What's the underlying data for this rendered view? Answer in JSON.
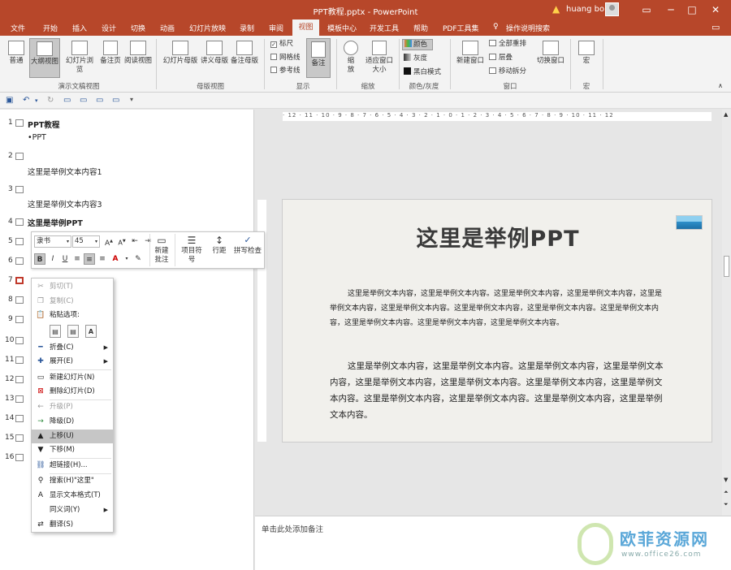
{
  "titlebar": {
    "title": "PPT教程.pptx - PowerPoint",
    "user": "huang bo",
    "controls": [
      "▭",
      "─",
      "□",
      "✕"
    ]
  },
  "menu": {
    "tabs": [
      "文件",
      "开始",
      "插入",
      "设计",
      "切换",
      "动画",
      "幻灯片放映",
      "录制",
      "审阅",
      "视图",
      "模板中心",
      "开发工具",
      "帮助",
      "PDF工具集",
      "操作说明搜索"
    ],
    "active": "视图"
  },
  "ribbon": {
    "views": {
      "normal": "普通",
      "outline": "大纲视图",
      "sorter": "幻灯片浏览",
      "notes_page": "备注页",
      "reading": "阅读视图",
      "group": "演示文稿视图"
    },
    "masters": {
      "slide": "幻灯片母版",
      "handout": "讲义母版",
      "notes": "备注母版",
      "group": "母版视图"
    },
    "show": {
      "ruler": "标尺",
      "gridlines": "网格线",
      "guides": "参考线",
      "notes": "备注",
      "group": "显示"
    },
    "zoom": {
      "zoom": "缩放",
      "fit": "适应窗口大小",
      "group": "缩放"
    },
    "color": {
      "color": "颜色",
      "gray": "灰度",
      "bw": "黑白模式",
      "group": "颜色/灰度"
    },
    "window": {
      "new": "新建窗口",
      "arrange": "全部重排",
      "cascade": "层叠",
      "move": "移动拆分",
      "switch": "切换窗口",
      "group": "窗口"
    },
    "macro": {
      "macro": "宏",
      "group": "宏"
    }
  },
  "outline": {
    "rows": [
      {
        "num": "1",
        "title": "PPT教程",
        "sub": "•PPT"
      },
      {
        "num": "2",
        "title": "",
        "sub": "这里是举例文本内容1"
      },
      {
        "num": "3",
        "title": "",
        "sub": "这里是举例文本内容3"
      },
      {
        "num": "4",
        "title": "这里是举例PPT"
      },
      {
        "num": "5"
      },
      {
        "num": "6"
      },
      {
        "num": "7"
      },
      {
        "num": "8"
      },
      {
        "num": "9"
      },
      {
        "num": "10"
      },
      {
        "num": "11"
      },
      {
        "num": "12"
      },
      {
        "num": "13"
      },
      {
        "num": "14"
      },
      {
        "num": "15"
      },
      {
        "num": "16"
      }
    ]
  },
  "minitoolbar": {
    "font": "隶书",
    "size": "45",
    "buttons": {
      "bold": "B",
      "italic": "I",
      "underline": "U"
    },
    "new_comment": "新建批注",
    "bullets": "项目符号",
    "spacing": "行距",
    "spellcheck": "拼写检查"
  },
  "context_menu": {
    "cut": "剪切(T)",
    "copy": "复制(C)",
    "paste_header": "粘贴选项:",
    "collapse": "折叠(C)",
    "expand": "展开(E)",
    "new_slide": "新建幻灯片(N)",
    "delete_slide": "删除幻灯片(D)",
    "promote": "升级(P)",
    "demote": "降级(D)",
    "move_up": "上移(U)",
    "move_down": "下移(M)",
    "hyperlink": "超链接(H)...",
    "search": "搜索(H)\"这里\"",
    "show_format": "显示文本格式(T)",
    "synonyms": "同义词(Y)",
    "translate": "翻译(S)"
  },
  "slide": {
    "title": "这里是举例PPT",
    "para1": "这里是举例文本内容，这里是举例文本内容。这里是举例文本内容，这里是举例文本内容，这里是举例文本内容，这里是举例文本内容。这里是举例文本内容，这里是举例文本内容。这里是举例文本内容，这里是举例文本内容。这里是举例文本内容，这里是举例文本内容。",
    "para2": "这里是举例文本内容，这里是举例文本内容。这里是举例文本内容，这里是举例文本内容，这里是举例文本内容，这里是举例文本内容。这里是举例文本内容，这里是举例文本内容。这里是举例文本内容，这里是举例文本内容。这里是举例文本内容，这里是举例文本内容。"
  },
  "ruler": {
    "text": "· 12 · 11 · 10 · 9 · 8 · 7 · 6 · 5 · 4 · 3 · 2 · 1 · 0 · 1 · 2 · 3 · 4 · 5 · 6 · 7 · 8 · 9 · 10 · 11 · 12"
  },
  "notes": {
    "placeholder": "单击此处添加备注"
  },
  "watermark": {
    "site": "欧菲资源网",
    "url": "www.office26.com"
  }
}
